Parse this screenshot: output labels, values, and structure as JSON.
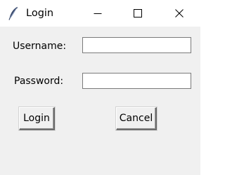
{
  "window": {
    "title": "Login",
    "app_icon": "feather-icon",
    "controls": {
      "minimize": "minimize-icon",
      "maximize": "maximize-icon",
      "close": "close-icon"
    }
  },
  "form": {
    "username_label": "Username:",
    "username_value": "",
    "password_label": "Password:",
    "password_value": ""
  },
  "buttons": {
    "login_label": "Login",
    "cancel_label": "Cancel"
  }
}
